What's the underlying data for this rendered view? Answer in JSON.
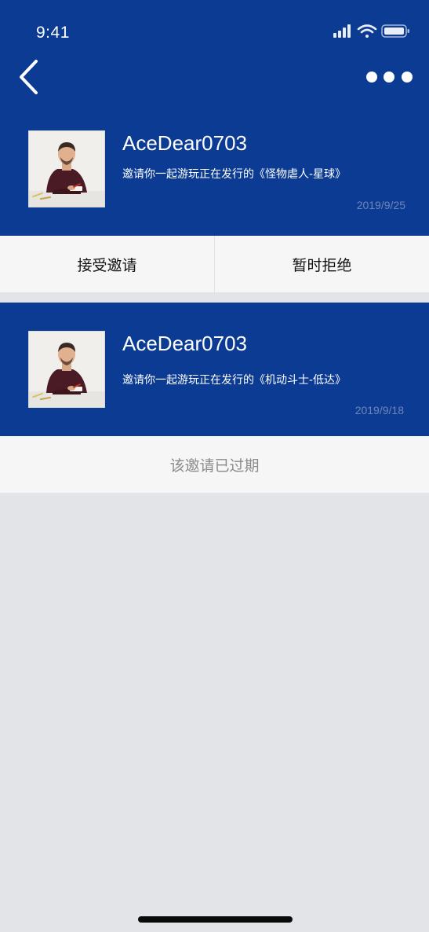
{
  "status_bar": {
    "time": "9:41",
    "icons": [
      "signal-icon",
      "wifi-icon",
      "battery-icon"
    ]
  },
  "nav": {
    "back_icon": "chevron-left-icon",
    "more_icon": "more-dots-icon"
  },
  "invites": [
    {
      "username": "AceDear0703",
      "message": "邀请你一起游玩正在发行的《怪物虐人-星球》",
      "date": "2019/9/25",
      "actions": {
        "accept": "接受邀请",
        "decline": "暂时拒绝"
      }
    },
    {
      "username": "AceDear0703",
      "message": "邀请你一起游玩正在发行的《机动斗士-低达》",
      "date": "2019/9/18",
      "status": "该邀请已过期"
    }
  ],
  "colors": {
    "brand_blue": "#0b3b93",
    "page_background": "#e3e4e8",
    "action_background": "#f6f6f6",
    "date_text": "#6f86b8",
    "expired_text": "#8a8a8a"
  }
}
